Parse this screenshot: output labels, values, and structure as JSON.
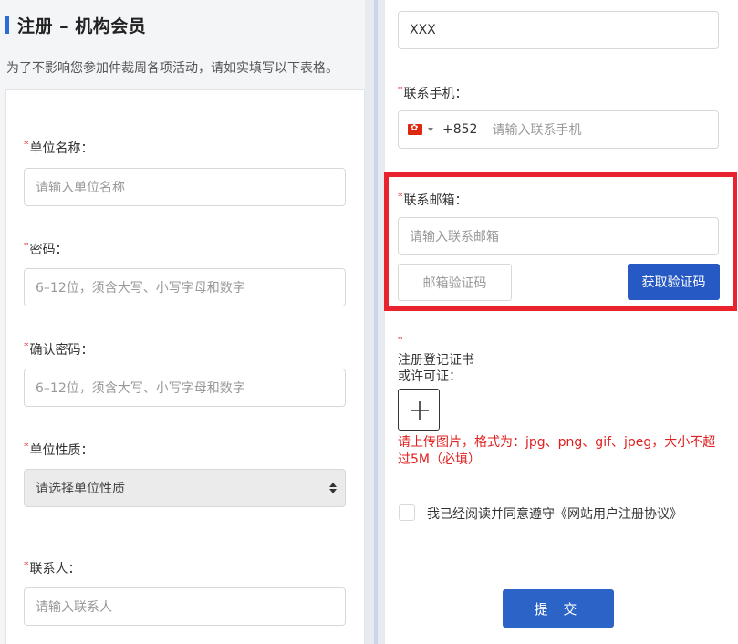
{
  "header": {
    "title": "注册 – 机构会员",
    "subtitle": "为了不影响您参加仲裁周各项活动，请如实填写以下表格。"
  },
  "required_mark": "*",
  "left_form": {
    "org_name": {
      "label": "单位名称：",
      "placeholder": "请输入单位名称"
    },
    "password": {
      "label": "密码：",
      "placeholder": "6–12位，须含大写、小写字母和数字"
    },
    "confirm_password": {
      "label": "确认密码：",
      "placeholder": "6–12位，须含大写、小写字母和数字"
    },
    "org_type": {
      "label": "单位性质：",
      "selected": "请选择单位性质"
    },
    "contact_person": {
      "label": "联系人：",
      "placeholder": "请输入联系人"
    }
  },
  "right_form": {
    "contact_person_value": "XXX",
    "mobile": {
      "label": "联系手机：",
      "country_code": "+852",
      "placeholder": "请输入联系手机",
      "flag": "hong-kong-flag"
    },
    "email": {
      "label": "联系邮箱：",
      "placeholder": "请输入联系邮箱",
      "code_placeholder": "邮箱验证码",
      "get_code_button": "获取验证码"
    },
    "upload": {
      "label_line1": "注册登记证书",
      "label_line2": "或许可证：",
      "hint": "请上传图片，格式为：jpg、png、gif、jpeg，大小不超过5M（必填）",
      "icon": "plus-icon"
    },
    "agreement": "我已经阅读并同意遵守《网站用户注册协议》",
    "submit_label": "提 交"
  },
  "colors": {
    "accent": "#2b6cd4",
    "primary_button": "#2659c3",
    "required": "#e02020",
    "highlight_border": "#e8232d"
  }
}
